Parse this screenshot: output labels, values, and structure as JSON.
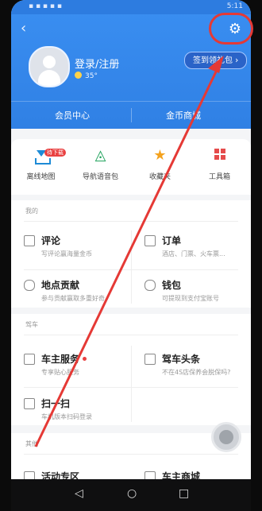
{
  "status_bar": {
    "left": "▪ ▪ ▪ ▪ ▪",
    "right": "5:11"
  },
  "header": {
    "login_text": "登录/注册",
    "temp": "35°",
    "signin_text": "签到领礼包"
  },
  "tabs": {
    "left": "会员中心",
    "right": "金币商城"
  },
  "quick_actions": [
    {
      "label": "离线地图",
      "badge": "待下载"
    },
    {
      "label": "导航语音包"
    },
    {
      "label": "收藏夹"
    },
    {
      "label": "工具箱"
    }
  ],
  "sections": {
    "mine": "我的",
    "drive": "驾车",
    "other": "其他"
  },
  "items": {
    "review": {
      "title": "评论",
      "sub": "写评论赢海量金币"
    },
    "order": {
      "title": "订单",
      "sub": "酒店、门票、火车票..."
    },
    "poi": {
      "title": "地点贡献",
      "sub": "参与贡献赢取多重好奇"
    },
    "wallet": {
      "title": "钱包",
      "sub": "可提现到支付宝账号"
    },
    "car_service": {
      "title": "车主服务",
      "sub": "专享贴心服务"
    },
    "drive_news": {
      "title": "驾车头条",
      "sub": "不在4S店保养会脱保吗?"
    },
    "scan": {
      "title": "扫一扫",
      "sub": "车机版本扫码登录"
    },
    "activity": {
      "title": "活动专区"
    },
    "car_mall": {
      "title": "车主商城"
    }
  },
  "colors": {
    "brand_blue": "#2f7fe3",
    "annotation_red": "#e53935"
  }
}
